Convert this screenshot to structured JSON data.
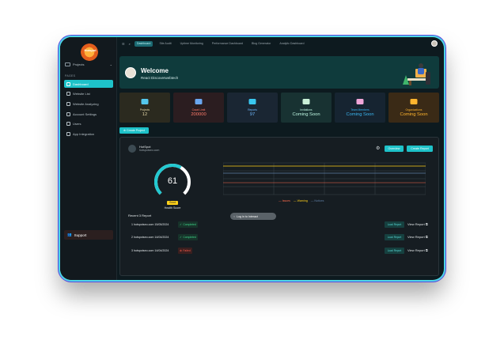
{
  "sidebar": {
    "logo_text": "Hotspot",
    "project_selector": "Projects",
    "section_label": "PAGES",
    "items": [
      {
        "label": "Dashboard",
        "active": true
      },
      {
        "label": "Website List",
        "active": false
      },
      {
        "label": "Website Analyzing",
        "active": false
      },
      {
        "label": "Account Settings",
        "active": false
      },
      {
        "label": "Users",
        "active": false
      },
      {
        "label": "App Integration",
        "active": false
      }
    ],
    "support_label": "Support"
  },
  "topbar": {
    "tabs": [
      {
        "label": "Dashboard",
        "active": true
      },
      {
        "label": "Site Audit",
        "active": false
      },
      {
        "label": "Uptime Monitoring",
        "active": false
      },
      {
        "label": "Performance Dashboard",
        "active": false
      },
      {
        "label": "Blog Generator",
        "active": false
      },
      {
        "label": "Analytic Dashboard",
        "active": false
      }
    ]
  },
  "welcome": {
    "title": "Welcome",
    "subtitle": "React Discoverwebtech"
  },
  "stats": [
    {
      "label": "Projects",
      "value": "12",
      "bg": "#2b2a1f",
      "icon_color": "#54c7ec",
      "label_color": "#e3d7a8",
      "value_color": "#e3d7a8"
    },
    {
      "label": "Crawl Limit",
      "value": "200000",
      "bg": "#2b1d20",
      "icon_color": "#6aa7f0",
      "label_color": "#ff7b6b",
      "value_color": "#ff7b6b"
    },
    {
      "label": "Reports",
      "value": "97",
      "bg": "#1a2633",
      "icon_color": "#39c7ef",
      "label_color": "#6fb8ff",
      "value_color": "#6fb8ff"
    },
    {
      "label": "Invitations",
      "value": "Coming Soon",
      "bg": "#183232",
      "icon_color": "#c9f0d7",
      "label_color": "#bdf5e0",
      "value_color": "#bdf5e0"
    },
    {
      "label": "Team Members",
      "value": "Coming Soon",
      "bg": "#162431",
      "icon_color": "#f0a6d8",
      "label_color": "#3bb6f0",
      "value_color": "#3bb6f0"
    },
    {
      "label": "Organizations",
      "value": "Coming Soon",
      "bg": "#3a2a16",
      "icon_color": "#ffb52e",
      "label_color": "#ffb52e",
      "value_color": "#ffb52e"
    }
  ],
  "actions": {
    "create_project": "⊕ Create Project",
    "overview": "Overview",
    "create_report": "Create Report"
  },
  "site": {
    "name": "HotSpot",
    "url": "hotspotseo.com"
  },
  "health": {
    "score": 61,
    "score_text": "61",
    "badge": "Good",
    "label": "Health Score",
    "colors": {
      "arc": "#22c9d1",
      "track": "#ffffff"
    }
  },
  "legend": {
    "items": [
      {
        "label": "— Issues",
        "color": "#ff6b4a"
      },
      {
        "label": "— Warning",
        "color": "#ffd11a"
      },
      {
        "label": "— Notices",
        "color": "#5f7fa6"
      }
    ]
  },
  "recent": {
    "title": "Recent 3 Report",
    "toast": "Log in to Interact",
    "rows": [
      {
        "name": "1 hotspotseo.com 15/05/2024",
        "status": "Completed",
        "type": "ok",
        "load": "Load Report",
        "view": "View Report ⧉"
      },
      {
        "name": "2 hotspotseo.com 14/04/2024",
        "status": "Completed",
        "type": "ok",
        "load": "Load Report",
        "view": "View Report ⧉"
      },
      {
        "name": "3 hotspotseo.com 14/04/2024",
        "status": "Failed",
        "type": "fail",
        "load": "Load Report",
        "view": "View Report ⧉"
      }
    ]
  }
}
